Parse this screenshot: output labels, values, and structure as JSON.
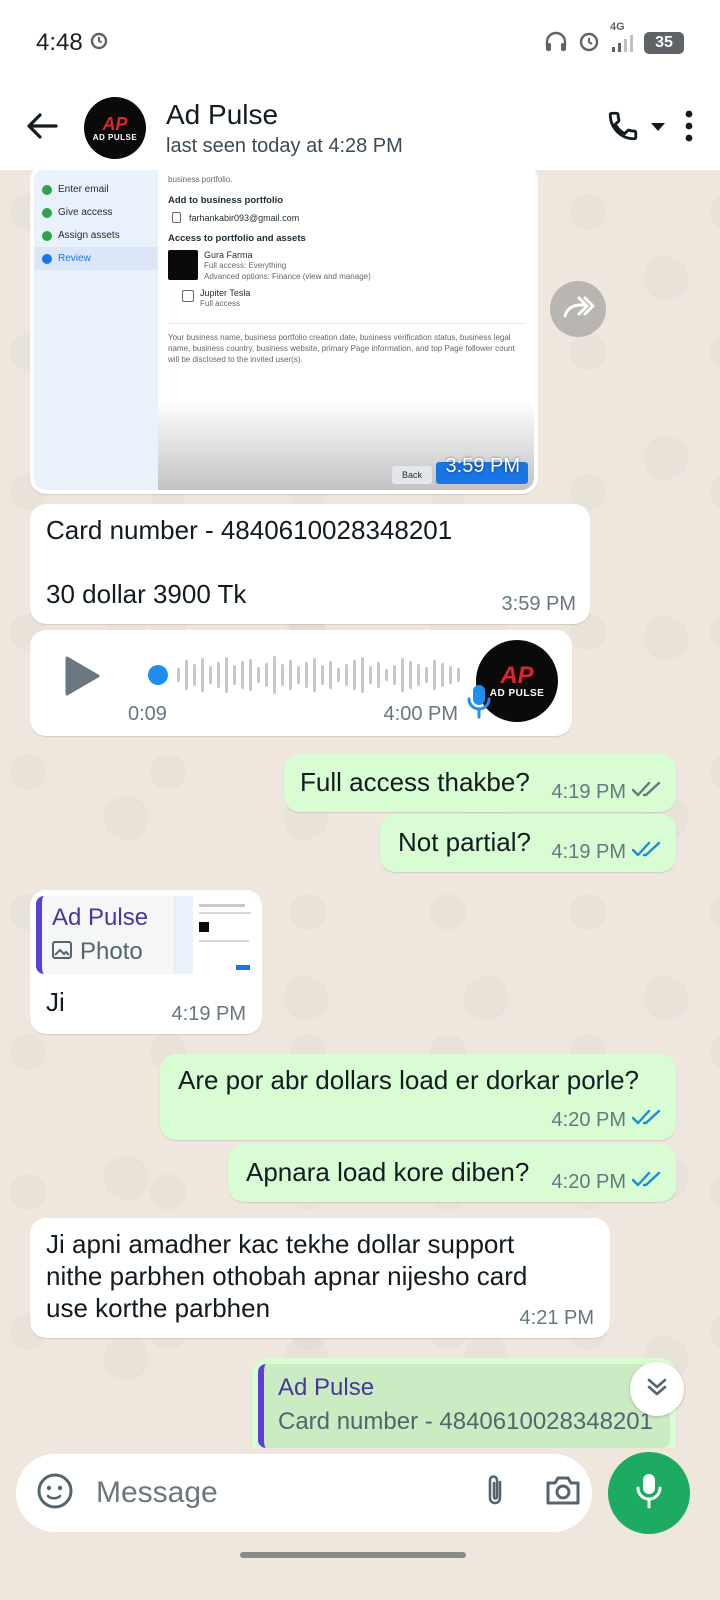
{
  "status_bar": {
    "time": "4:48",
    "network": "4G",
    "battery": "35"
  },
  "header": {
    "contact_name": "Ad Pulse",
    "last_seen": "last seen today at 4:28 PM",
    "logo_mark": "AP",
    "logo_text": "AD PULSE"
  },
  "messages": {
    "image": {
      "time": "3:59 PM",
      "screenshot": {
        "side_items": [
          "Enter email",
          "Give access",
          "Assign assets",
          "Review"
        ],
        "intro": "business portfolio.",
        "section1": "Add to business portfolio",
        "email": "farhankabir093@gmail.com",
        "section2": "Access to portfolio and assets",
        "asset1_name": "Gura Farma",
        "asset1_line1": "Full access: Everything",
        "asset1_line2": "Advanced options: Finance (view and manage)",
        "asset2_name": "Jupiter Tesla",
        "asset2_line1": "Full access",
        "disclaimer": "Your business name, business portfolio creation date, business verification status, business legal name, business country, business website, primary Page information, and top Page follower count will be disclosed to the invited user(s).",
        "back_label": "Back"
      }
    },
    "card": {
      "line1": "Card number - 4840610028348201",
      "line2": "30 dollar 3900 Tk",
      "time": "3:59 PM"
    },
    "voice": {
      "duration": "0:09",
      "time": "4:00 PM"
    },
    "out1": {
      "text": "Full access thakbe?",
      "time": "4:19 PM",
      "status": "delivered"
    },
    "out2": {
      "text": "Not partial?",
      "time": "4:19 PM",
      "status": "read"
    },
    "reply1": {
      "quote_name": "Ad Pulse",
      "quote_type": "Photo",
      "text": "Ji",
      "time": "4:19 PM"
    },
    "out3": {
      "text": "Are por abr dollars load er dorkar porle?",
      "time": "4:20 PM",
      "status": "read"
    },
    "out4": {
      "text": "Apnara load kore diben?",
      "time": "4:20 PM",
      "status": "read"
    },
    "in_long": {
      "text": "Ji apni amadher kac tekhe dollar support nithe parbhen othobah apnar nijesho card use korthe parbhen",
      "time": "4:21 PM"
    },
    "out_quote": {
      "quote_name": "Ad Pulse",
      "quote_text": "Card number - 4840610028348201"
    }
  },
  "composer": {
    "placeholder": "Message"
  },
  "colors": {
    "outgoing_bubble": "#d9fdd3",
    "incoming_bubble": "#ffffff",
    "chat_background": "#efe7de",
    "read_tick": "#53bdeb",
    "accent_green": "#1daa61",
    "quote_bar": "#5c3fd8"
  },
  "icons": [
    "alarm-icon",
    "headphones-icon",
    "signal-icon",
    "back-arrow-icon",
    "phone-icon",
    "dropdown-icon",
    "more-icon",
    "forward-icon",
    "play-icon",
    "mic-icon",
    "photo-icon",
    "double-chevron-down-icon",
    "sticker-icon",
    "attach-icon",
    "camera-icon"
  ]
}
